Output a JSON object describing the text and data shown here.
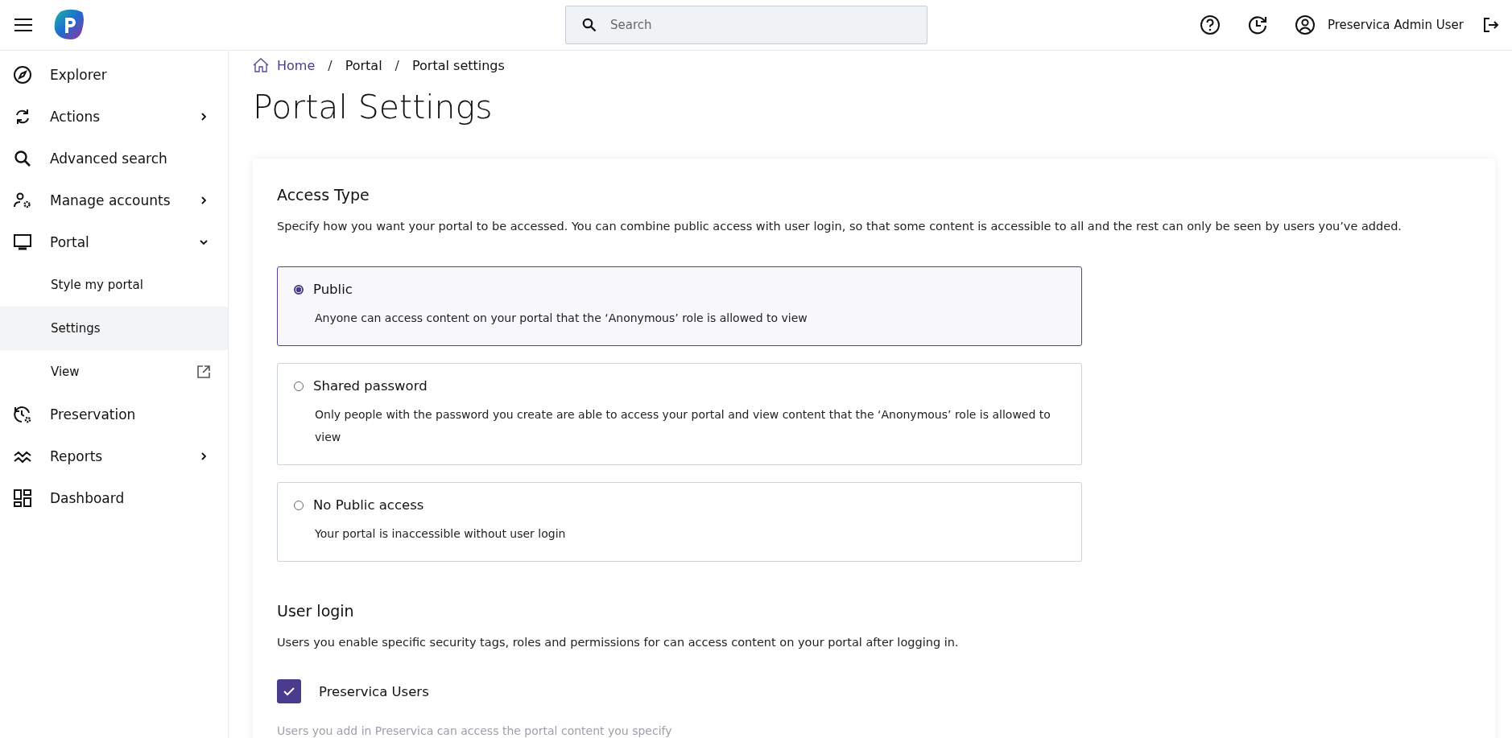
{
  "header": {
    "search": {
      "placeholder": "Search"
    },
    "user": "Preservica Admin User"
  },
  "sidebar": {
    "items": [
      {
        "label": "Explorer",
        "kind": "link",
        "selected": false
      },
      {
        "label": "Actions",
        "kind": "menu",
        "expanded": false,
        "selected": false
      },
      {
        "label": "Advanced search",
        "kind": "link",
        "selected": false
      },
      {
        "label": "Manage accounts",
        "kind": "menu",
        "expanded": false,
        "selected": false
      },
      {
        "label": "Portal",
        "kind": "menu",
        "expanded": true,
        "selected": false,
        "children": [
          {
            "label": "Style my portal",
            "kind": "link",
            "selected": false
          },
          {
            "label": "Settings",
            "kind": "link",
            "selected": true
          },
          {
            "label": "View",
            "kind": "external",
            "selected": false
          }
        ]
      },
      {
        "label": "Preservation",
        "kind": "link",
        "selected": false
      },
      {
        "label": "Reports",
        "kind": "menu",
        "expanded": false,
        "selected": false
      },
      {
        "label": "Dashboard",
        "kind": "link",
        "selected": false
      }
    ]
  },
  "breadcrumb": [
    {
      "kind": "link",
      "text": "Home"
    },
    {
      "kind": "separator",
      "text": "/"
    },
    {
      "kind": "link",
      "text": "Portal"
    },
    {
      "kind": "separator",
      "text": "/"
    },
    {
      "kind": "current",
      "text": "Portal settings"
    }
  ],
  "page_title": "Portal Settings",
  "access_type": {
    "heading": "Access Type",
    "description": "Specify how you want your portal to be accessed. You can combine public access with user login, so that some content is accessible to all and the rest can only be seen by users you’ve added.",
    "options": [
      {
        "label": "Public",
        "description": "Anyone can access content on your portal that the ‘Anonymous’ role is allowed to view",
        "selected": true
      },
      {
        "label": "Shared password",
        "description": "Only people with the password you create are able to access your portal and view content that the ‘Anonymous’ role is allowed to view",
        "selected": false
      },
      {
        "label": "No Public access",
        "description": "Your portal is inaccessible without user login",
        "selected": false
      }
    ]
  },
  "user_login": {
    "heading": "User login",
    "description": "Users you enable specific security tags, roles and permissions for can access content on your portal after logging in.",
    "checkbox": {
      "label": "Preservica Users",
      "checked": true
    },
    "hint": "Users you add in Preservica can access the portal content you specify"
  }
}
